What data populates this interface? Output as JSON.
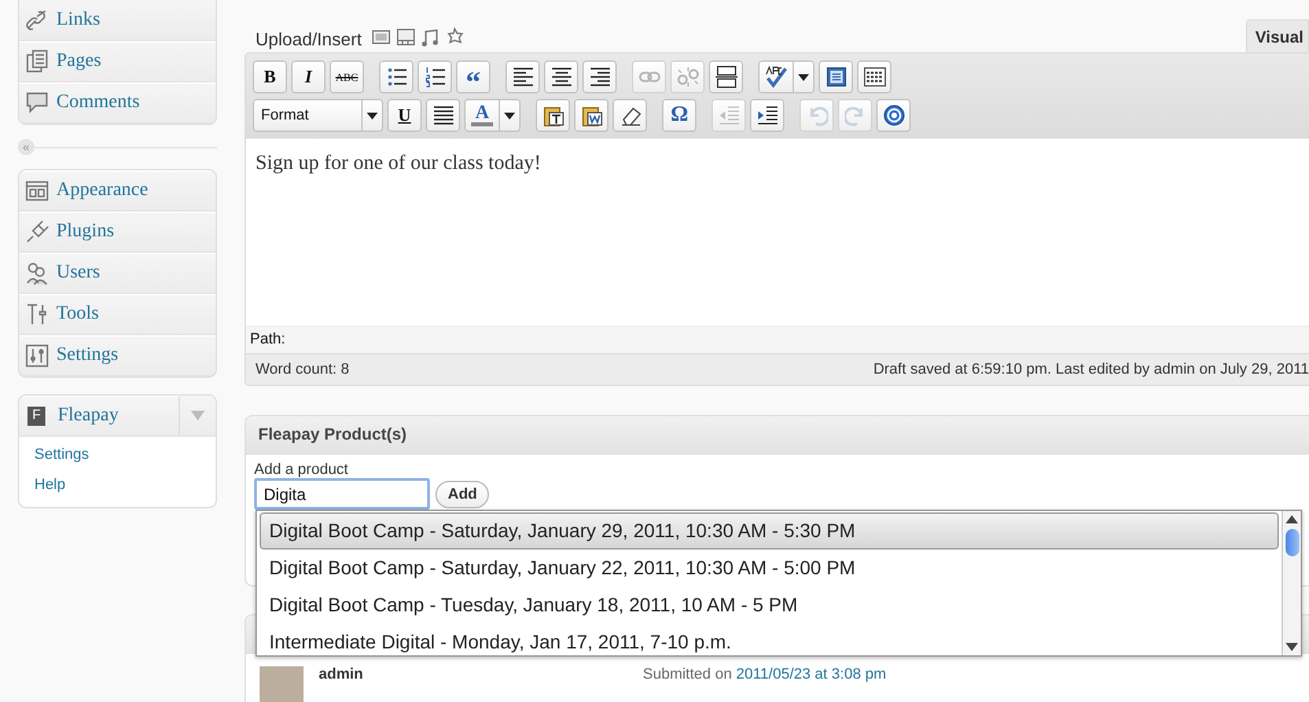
{
  "sidebar": {
    "groups": [
      {
        "items": [
          {
            "label": "Links",
            "kind": "link"
          },
          {
            "label": "Pages",
            "kind": "pages"
          },
          {
            "label": "Comments",
            "kind": "comment"
          }
        ]
      },
      {
        "items": [
          {
            "label": "Appearance",
            "kind": "appearance"
          },
          {
            "label": "Plugins",
            "kind": "plugin"
          },
          {
            "label": "Users",
            "kind": "users"
          },
          {
            "label": "Tools",
            "kind": "tools"
          },
          {
            "label": "Settings",
            "kind": "settings"
          }
        ]
      }
    ],
    "collapse": "«",
    "plugin_menu": {
      "logo": "F",
      "label": "Fleapay",
      "expanded": true,
      "submenu": [
        "Settings",
        "Help"
      ]
    }
  },
  "editor": {
    "upload_label": "Upload/Insert",
    "tab": {
      "label": "Visual",
      "selected": true
    },
    "toolbar_rows": [
      [
        {
          "kind": "bold",
          "label": "B",
          "disabled": false
        },
        {
          "kind": "italic",
          "label": "I",
          "disabled": false
        },
        {
          "kind": "strike",
          "label": "ABC",
          "disabled": false
        },
        {
          "kind": "sep"
        },
        {
          "kind": "ul",
          "disabled": false
        },
        {
          "kind": "ol",
          "disabled": false
        },
        {
          "kind": "quote",
          "label": "“",
          "disabled": false
        },
        {
          "kind": "sep"
        },
        {
          "kind": "align-left",
          "disabled": false
        },
        {
          "kind": "align-center",
          "disabled": false
        },
        {
          "kind": "align-right",
          "disabled": false
        },
        {
          "kind": "sep"
        },
        {
          "kind": "link",
          "disabled": true
        },
        {
          "kind": "unlink",
          "disabled": true
        },
        {
          "kind": "more",
          "disabled": false
        },
        {
          "kind": "sep"
        },
        {
          "kind": "spell",
          "disabled": false
        },
        {
          "kind": "fullscreen",
          "disabled": false
        },
        {
          "kind": "kitchen",
          "disabled": false
        }
      ],
      [
        {
          "kind": "format",
          "label": "Format",
          "disabled": false
        },
        {
          "kind": "underline",
          "label": "U",
          "disabled": false
        },
        {
          "kind": "justify",
          "disabled": false
        },
        {
          "kind": "color",
          "label": "A",
          "disabled": false
        },
        {
          "kind": "sep"
        },
        {
          "kind": "paste-text",
          "disabled": false
        },
        {
          "kind": "paste-word",
          "disabled": false
        },
        {
          "kind": "eraser",
          "disabled": false
        },
        {
          "kind": "sep"
        },
        {
          "kind": "omega",
          "label": "Ω",
          "disabled": false
        },
        {
          "kind": "sep"
        },
        {
          "kind": "outdent",
          "disabled": true
        },
        {
          "kind": "indent",
          "disabled": false
        },
        {
          "kind": "sep"
        },
        {
          "kind": "undo",
          "disabled": true
        },
        {
          "kind": "redo",
          "disabled": true
        },
        {
          "kind": "help",
          "disabled": false
        }
      ]
    ],
    "content": "Sign up for one of our class today!",
    "path_label": "Path:",
    "word_count": "Word count: 8",
    "draft_status": "Draft saved at 6:59:10 pm. Last edited by admin on July 29, 2011"
  },
  "product_box": {
    "title": "Fleapay Product(s)",
    "field_label": "Add a product",
    "value": "Digita",
    "add_button": "Add",
    "suggestions": [
      {
        "label": "Digital Boot Camp - Saturday, January 29, 2011, 10:30 AM - 5:30 PM",
        "selected": true
      },
      {
        "label": "Digital Boot Camp - Saturday, January 22, 2011, 10:30 AM - 5:00 PM",
        "selected": false
      },
      {
        "label": "Digital Boot Camp - Tuesday, January 18, 2011, 10 AM - 5 PM",
        "selected": false
      },
      {
        "label": "Intermediate Digital - Monday, Jan 17, 2011, 7-10 p.m.",
        "selected": false
      }
    ]
  },
  "comment": {
    "author": "admin",
    "submitted_label": "Submitted on",
    "submitted_link": "2011/05/23 at 3:08 pm"
  }
}
